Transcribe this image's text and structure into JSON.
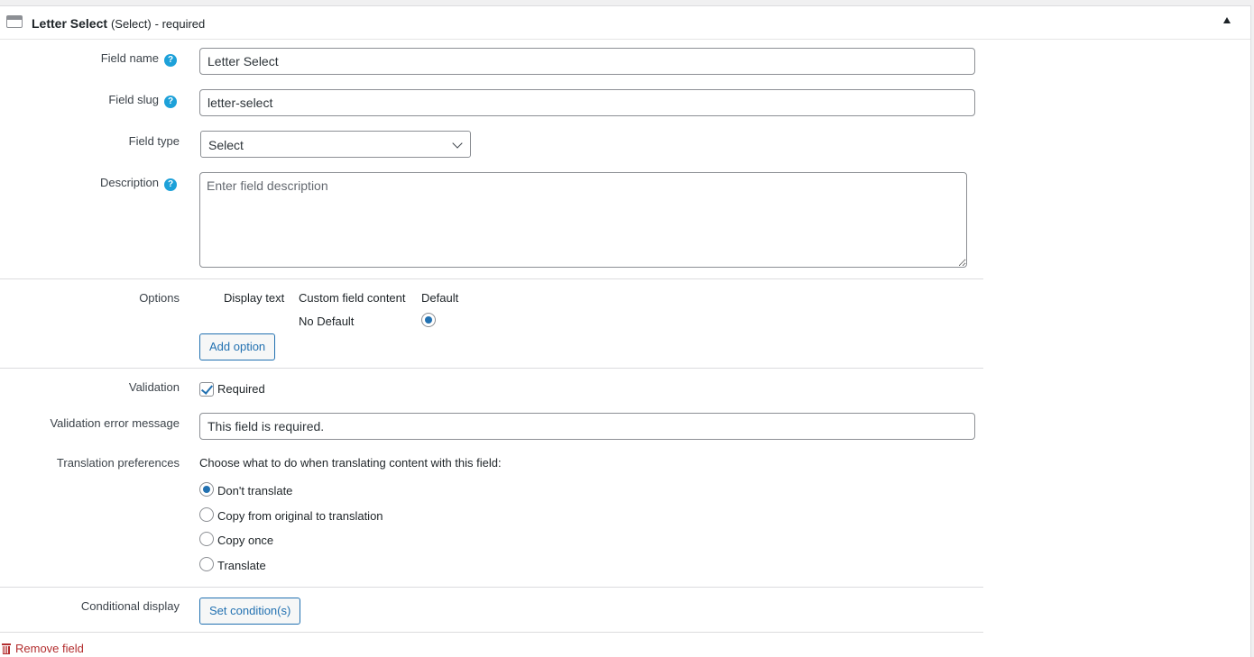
{
  "header": {
    "title": "Letter Select",
    "type": "(Select)",
    "required_suffix": "- required"
  },
  "fields": {
    "field_name": {
      "label": "Field name",
      "value": "Letter Select"
    },
    "field_slug": {
      "label": "Field slug",
      "value": "letter-select"
    },
    "field_type": {
      "label": "Field type",
      "value": "Select"
    },
    "description": {
      "label": "Description",
      "placeholder": "Enter field description"
    }
  },
  "help_icon_glyph": "?",
  "options": {
    "label": "Options",
    "columns": [
      "Display text",
      "Custom field content",
      "Default"
    ],
    "no_default_label": "No Default",
    "no_default_checked": true,
    "add_option_label": "Add option"
  },
  "validation": {
    "label": "Validation",
    "required_label": "Required",
    "required_checked": true,
    "error_message_label": "Validation error message",
    "error_message_value": "This field is required."
  },
  "translation": {
    "label": "Translation preferences",
    "intro": "Choose what to do when translating content with this field:",
    "choices": [
      {
        "label": "Don't translate",
        "checked": true
      },
      {
        "label": "Copy from original to translation",
        "checked": false
      },
      {
        "label": "Copy once",
        "checked": false
      },
      {
        "label": "Translate",
        "checked": false
      }
    ]
  },
  "conditional": {
    "label": "Conditional display",
    "button_label": "Set condition(s)"
  },
  "remove_field_label": "Remove field",
  "colors": {
    "accent": "#2271b1",
    "help": "#1da1d9",
    "danger": "#b32d2e"
  }
}
